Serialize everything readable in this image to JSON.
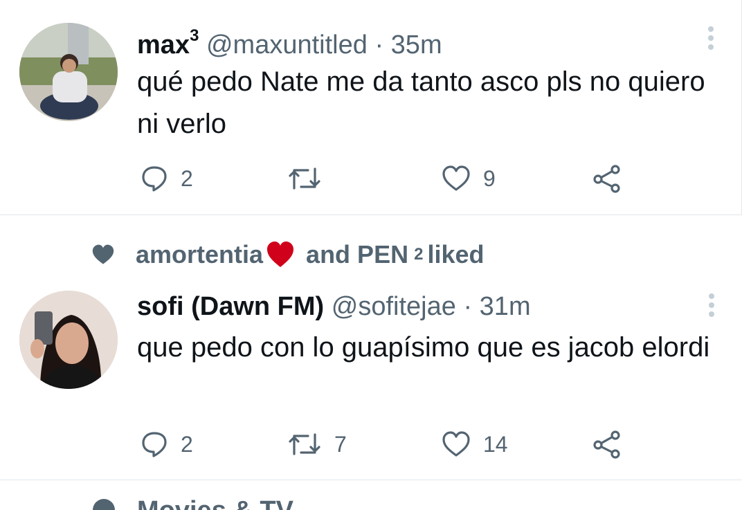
{
  "tweets": [
    {
      "name": "max",
      "name_sup": "3",
      "handle": "@maxuntitled",
      "separator": "·",
      "time": "35m",
      "text": "qué pedo Nate me da tanto asco pls no quiero ni verlo",
      "replies": "2",
      "retweets": "",
      "likes": "9"
    },
    {
      "social_context": {
        "user1": "amortentia",
        "user1_emoji": "♥",
        "middle": "and PEN",
        "sup": "2",
        "end": "liked"
      },
      "name": "sofi (Dawn FM)",
      "handle": "@sofitejae",
      "separator": "·",
      "time": "31m",
      "text": "que pedo con lo guapísimo que es jacob elordi",
      "replies": "2",
      "retweets": "7",
      "likes": "14"
    }
  ],
  "next_item": {
    "text": "Movies & TV"
  },
  "colors": {
    "text": "#0f1419",
    "secondary": "#536471",
    "divider": "#e1e8ed",
    "heart_red": "#d0021b"
  },
  "icons": [
    "reply-icon",
    "retweet-icon",
    "like-icon",
    "share-icon",
    "more-icon",
    "liked-heart-icon"
  ]
}
